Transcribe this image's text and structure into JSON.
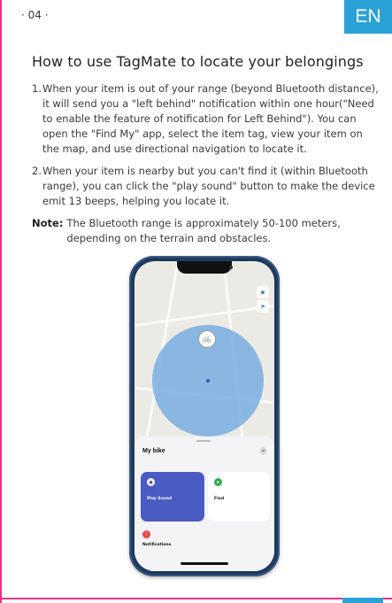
{
  "header": {
    "page_number": "· 04 ·",
    "language": "EN"
  },
  "section": {
    "title": "How to use TagMate to locate your belongings",
    "paragraphs": [
      {
        "num": "1.",
        "text": "When your item is out of your range (beyond Bluetooth distance), it will send you a \"left behind\" notification within one hour(\"Need to enable the feature of notification for Left Behind\"). You can open the \"Find My\" app, select the item tag, view your item on the map, and use directional navigation to locate it."
      },
      {
        "num": "2.",
        "text": "When your item is nearby but you can't find it (within Bluetooth range), you can click the \"play sound\" button to make the device emit 13 beeps, helping you locate it."
      }
    ],
    "note": {
      "label": "Note:",
      "text": "The Bluetooth range is approximately 50-100 meters, depending on the terrain and obstacles."
    }
  },
  "phone": {
    "item_title": "My bike",
    "play_sound": "Play Sound",
    "find": "Find",
    "notifications": "Notifications"
  },
  "colors": {
    "accent": "#2aa2d8",
    "frame": "#e8328c",
    "range": "#7fb1e0",
    "play_card": "#4a5bc4"
  }
}
